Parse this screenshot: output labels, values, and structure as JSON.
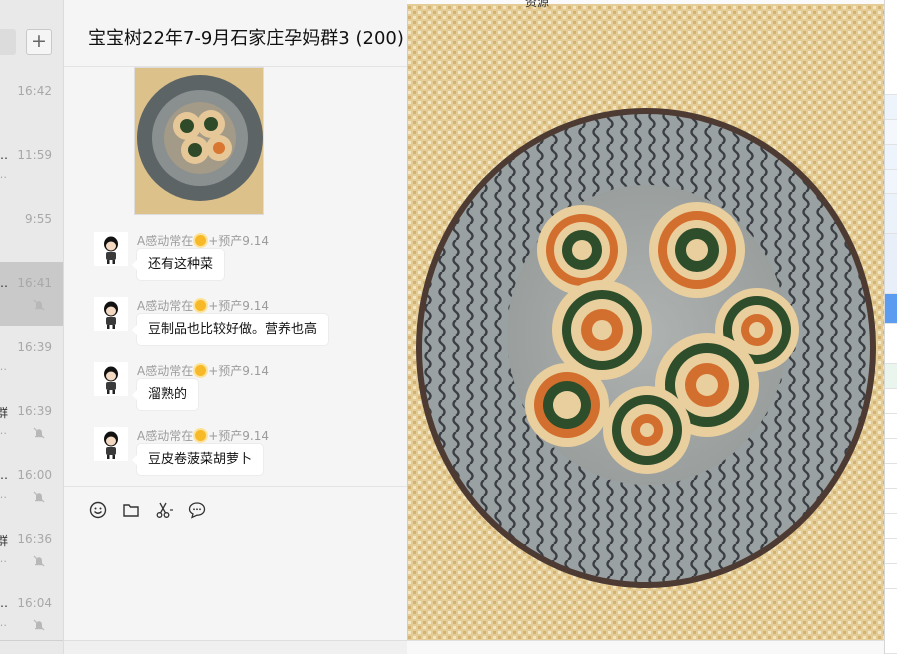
{
  "chat": {
    "title": "宝宝树22年7-9月石家庄孕妈群3 (200)",
    "messages": [
      {
        "sender_prefix": "A感动常在",
        "sender_suffix": "+预产9.14",
        "text": "还有这种菜"
      },
      {
        "sender_prefix": "A感动常在",
        "sender_suffix": "+预产9.14",
        "text": "豆制品也比较好做。营养也高"
      },
      {
        "sender_prefix": "A感动常在",
        "sender_suffix": "+预产9.14",
        "text": "溜熟的"
      },
      {
        "sender_prefix": "A感动常在",
        "sender_suffix": "+预产9.14",
        "text": "豆皮卷菠菜胡萝卜"
      }
    ],
    "toolbar": [
      "emoji-icon",
      "folder-icon",
      "scissors-icon",
      "chat-bubble-icon"
    ]
  },
  "conversations": [
    {
      "time": "16:42",
      "line1": "",
      "line2": "",
      "muted": false,
      "active": false
    },
    {
      "time": "11:59",
      "line1": "…",
      "line2": "…",
      "muted": false,
      "active": false
    },
    {
      "time": "9:55",
      "line1": "",
      "line2": "",
      "muted": false,
      "active": false
    },
    {
      "time": "16:41",
      "line1": "…",
      "line2": "",
      "muted": true,
      "active": true
    },
    {
      "time": "16:39",
      "line1": "",
      "line2": "…",
      "muted": false,
      "active": false
    },
    {
      "time": "16:39",
      "line1": "群",
      "line2": "…",
      "muted": true,
      "active": false
    },
    {
      "time": "16:00",
      "line1": "…",
      "line2": "…",
      "muted": true,
      "active": false
    },
    {
      "time": "16:36",
      "line1": "群",
      "line2": "…",
      "muted": true,
      "active": false
    },
    {
      "time": "16:04",
      "line1": "…",
      "line2": "…",
      "muted": true,
      "active": false
    }
  ],
  "viewer": {
    "caption_fragment": "资源"
  },
  "colors": {
    "accent": "#5b9cf0",
    "plate": "#5d6466",
    "tablecloth": "#dcc18a"
  }
}
